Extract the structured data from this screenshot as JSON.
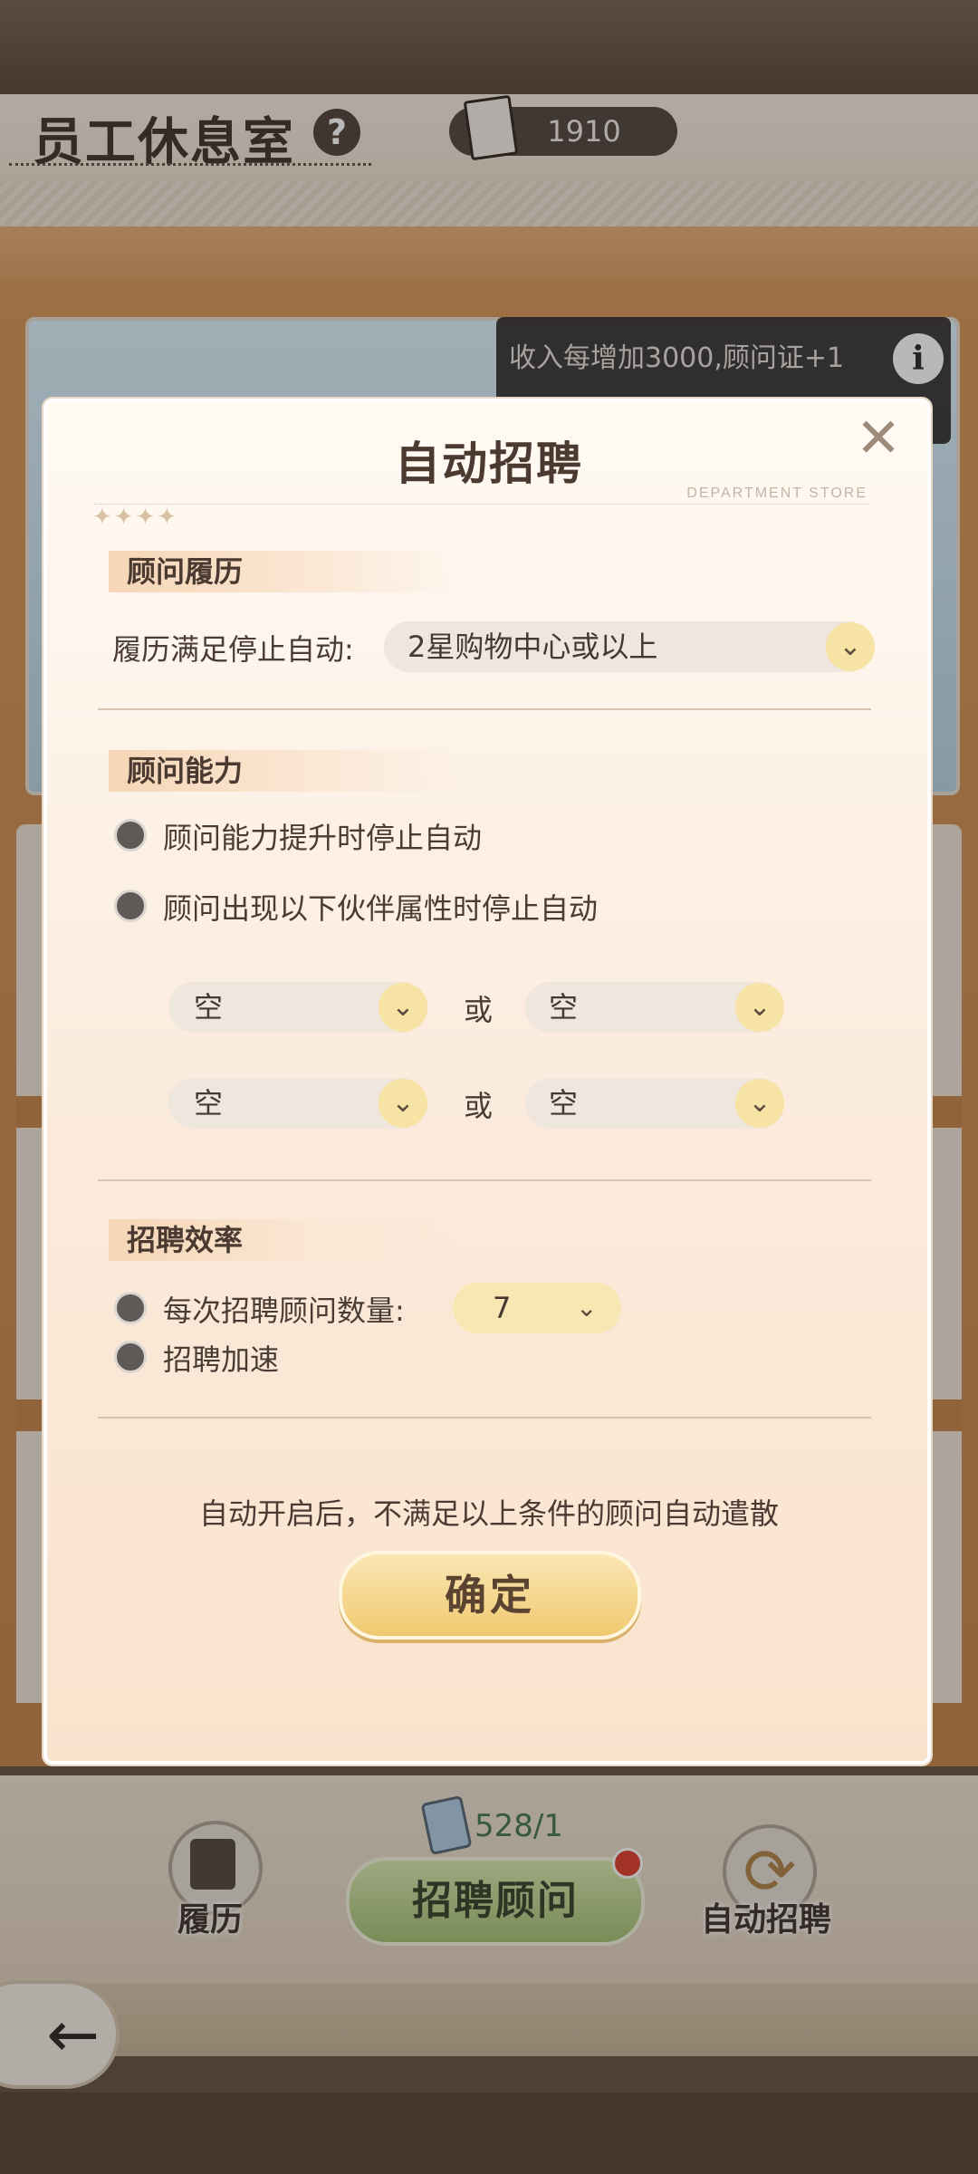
{
  "header": {
    "title": "员工休息室",
    "help_glyph": "?",
    "certificates": "1910"
  },
  "banner": {
    "text": "收入每增加3000,顾问证+1",
    "info_glyph": "i"
  },
  "bottom": {
    "resume_label": "履历",
    "cert_count": "528/1",
    "recruit_label": "招聘顾问",
    "auto_label": "自动招聘",
    "back_glyph": "←"
  },
  "modal": {
    "title": "自动招聘",
    "close_glyph": "✕",
    "subtitle": "DEPARTMENT STORE",
    "sparkles": "✦✦✦✦",
    "resume_section": {
      "heading": "顾问履历",
      "stop_label": "履历满足停止自动:",
      "stop_value": "2星购物中心或以上"
    },
    "ability_section": {
      "heading": "顾问能力",
      "option1": "顾问能力提升时停止自动",
      "option2": "顾问出现以下伙伴属性时停止自动",
      "or_label": "或",
      "slots": [
        "空",
        "空",
        "空",
        "空"
      ]
    },
    "efficiency_section": {
      "heading": "招聘效率",
      "count_label": "每次招聘顾问数量:",
      "count_value": "7",
      "speedup_label": "招聘加速"
    },
    "note": "自动开启后，不满足以上条件的顾问自动遣散",
    "confirm_label": "确定"
  },
  "icons": {
    "chevron": "⌄"
  }
}
